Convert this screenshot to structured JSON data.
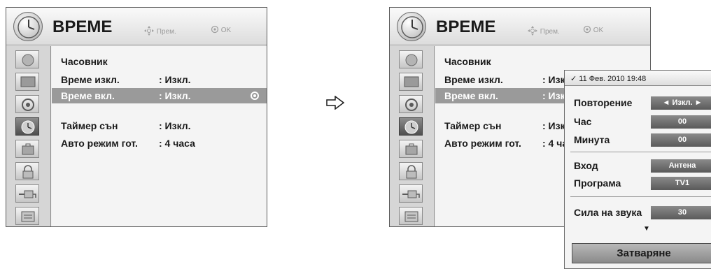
{
  "menu": {
    "title": "ВРЕМЕ",
    "hint_move": "Прем.",
    "hint_ok": "OK",
    "sidebar_icons": [
      "satellite-icon",
      "picture-icon",
      "audio-icon",
      "clock-icon",
      "suitcase-icon",
      "lock-icon",
      "input-icon",
      "media-icon"
    ],
    "active_icon": "clock-icon",
    "items": [
      {
        "label": "Часовник",
        "value": ""
      },
      {
        "label": "Време изкл.",
        "value": ": Изкл."
      },
      {
        "label": "Време вкл.",
        "value": ": Изкл."
      },
      {
        "label": "Таймер сън",
        "value": ": Изкл."
      },
      {
        "label": "Авто режим гот.",
        "value": ": 4 часа"
      }
    ],
    "items_right": [
      {
        "label": "Часовник",
        "value": ""
      },
      {
        "label": "Време изкл.",
        "value": ": Изк"
      },
      {
        "label": "Време вкл.",
        "value": ": Изк"
      },
      {
        "label": "Таймер сън",
        "value": ": Изк"
      },
      {
        "label": "Авто режим гот.",
        "value": ": 4 ча"
      }
    ],
    "selected_index": 2
  },
  "popup": {
    "date": "✓ 11 Фев. 2010 19:48",
    "rows": [
      {
        "label": "Повторение",
        "value": "◄ Изкл. ►"
      },
      {
        "label": "Час",
        "value": "00"
      },
      {
        "label": "Минута",
        "value": "00"
      },
      {
        "label": "Вход",
        "value": "Антена"
      },
      {
        "label": "Програма",
        "value": "TV1"
      },
      {
        "label": "Сила на звука",
        "value": "30"
      }
    ],
    "scroll_down": "▼",
    "close_label": "Затваряне"
  },
  "colors": {
    "selected_row": "#9a9a9a",
    "active_icon": "#5a5a5a",
    "value_box": "#6e6e6e"
  }
}
